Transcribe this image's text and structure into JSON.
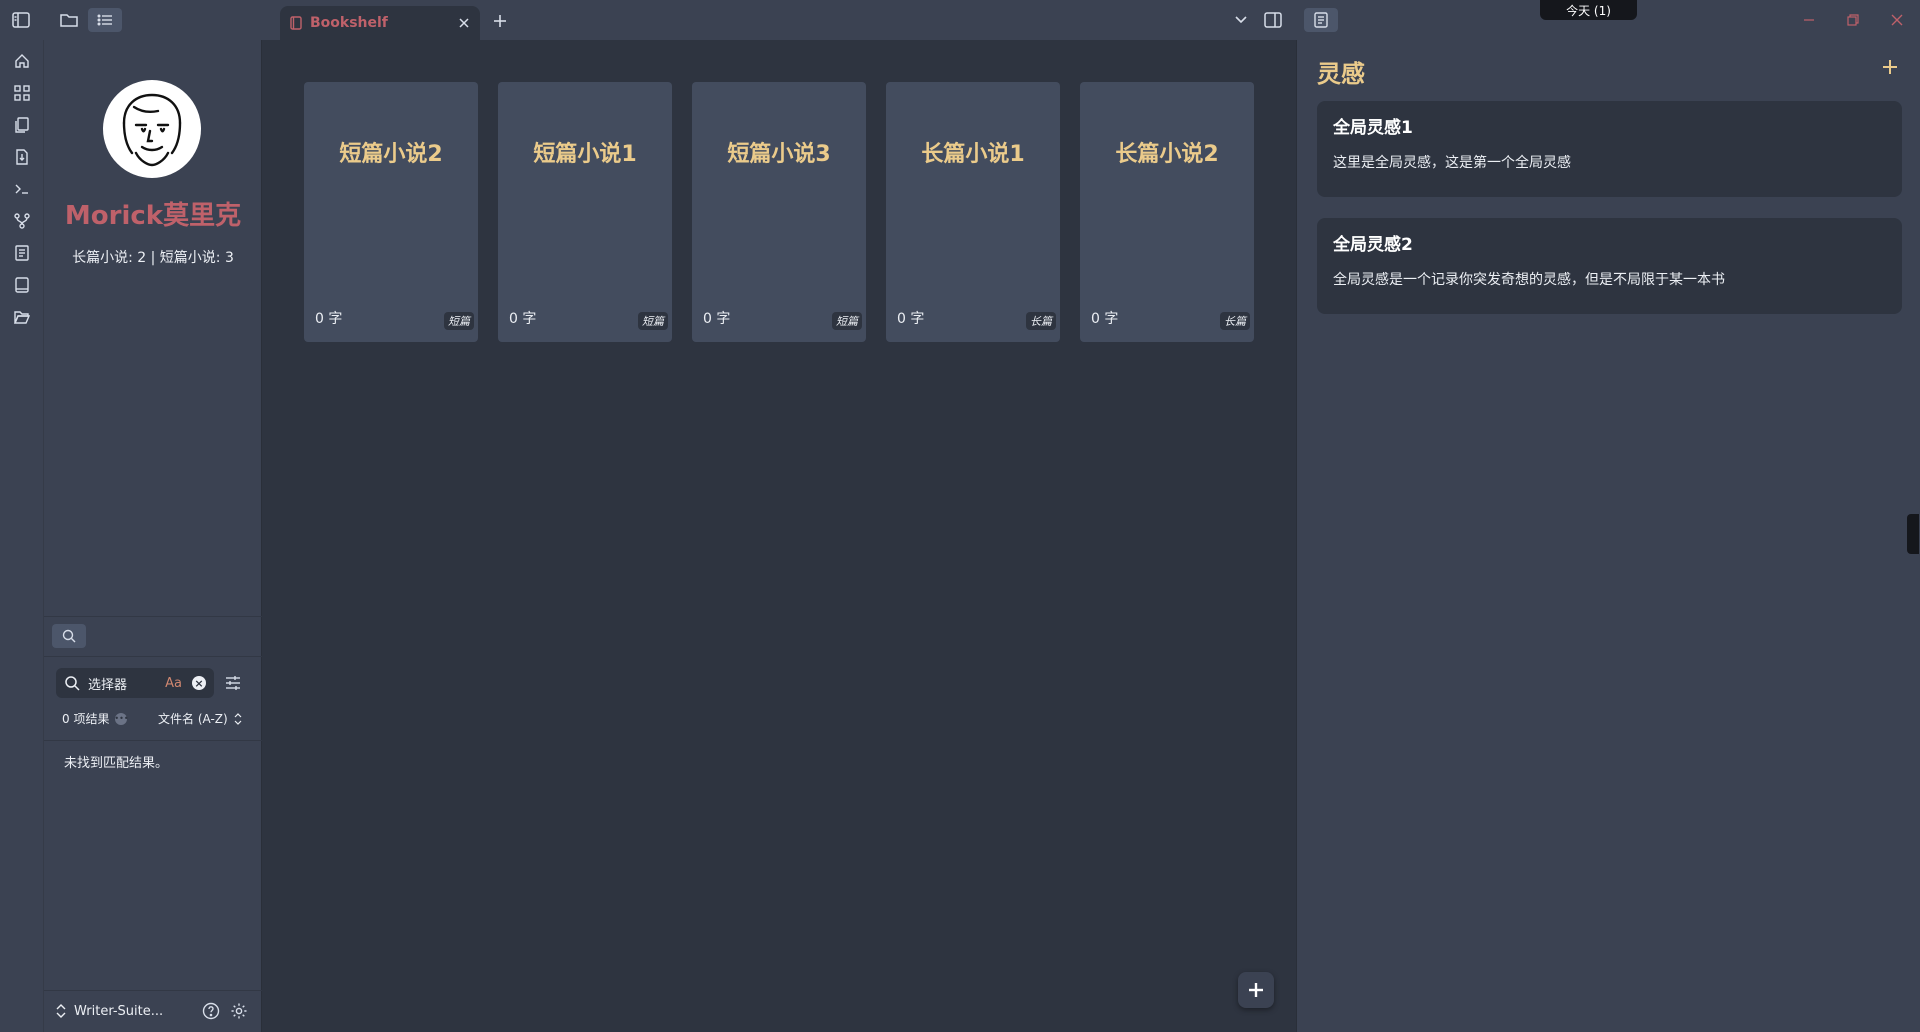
{
  "tabs": [
    {
      "label": "Bookshelf",
      "active": true
    }
  ],
  "titlebar": {
    "today_badge": "今天 (1)"
  },
  "profile": {
    "name": "Morick莫里克",
    "stats": "长篇小说: 2 | 短篇小说: 3"
  },
  "search": {
    "value": "选择器",
    "case_toggle": "Aa",
    "result_count": "0 项结果",
    "sort": "文件名 (A-Z)",
    "no_match": "未找到匹配结果。"
  },
  "vault": {
    "name": "Writer-Suite..."
  },
  "books": [
    {
      "title": "短篇小说2",
      "words": "0 字",
      "type": "短篇"
    },
    {
      "title": "短篇小说1",
      "words": "0 字",
      "type": "短篇"
    },
    {
      "title": "短篇小说3",
      "words": "0 字",
      "type": "短篇"
    },
    {
      "title": "长篇小说1",
      "words": "0 字",
      "type": "长篇"
    },
    {
      "title": "长篇小说2",
      "words": "0 字",
      "type": "长篇"
    }
  ],
  "inspiration": {
    "title": "灵感",
    "items": [
      {
        "title": "全局灵感1",
        "body": "这里是全局灵感，这是第一个全局灵感"
      },
      {
        "title": "全局灵感2",
        "body": "全局灵感是一个记录你突发奇想的灵感，但是不局限于某一本书"
      }
    ]
  },
  "colors": {
    "accent_red": "#bf616a",
    "accent_yellow": "#ebcb8b",
    "bg_main": "#2e3440",
    "bg_panel": "#3b4252",
    "card": "#434c5e"
  },
  "icons": [
    "sidebar-toggle-icon",
    "folder-icon",
    "list-icon",
    "book-icon",
    "close-icon",
    "plus-icon",
    "chevron-down-icon",
    "split-view-icon",
    "document-icon",
    "minimize-icon",
    "restore-icon",
    "window-close-icon",
    "home-icon",
    "grid-icon",
    "files-icon",
    "file-export-icon",
    "terminal-icon",
    "git-branch-icon",
    "note-icon",
    "bookshelf-icon",
    "folder-open-icon",
    "search-icon",
    "sliders-icon",
    "chevron-updown-icon",
    "help-icon",
    "gear-icon"
  ]
}
